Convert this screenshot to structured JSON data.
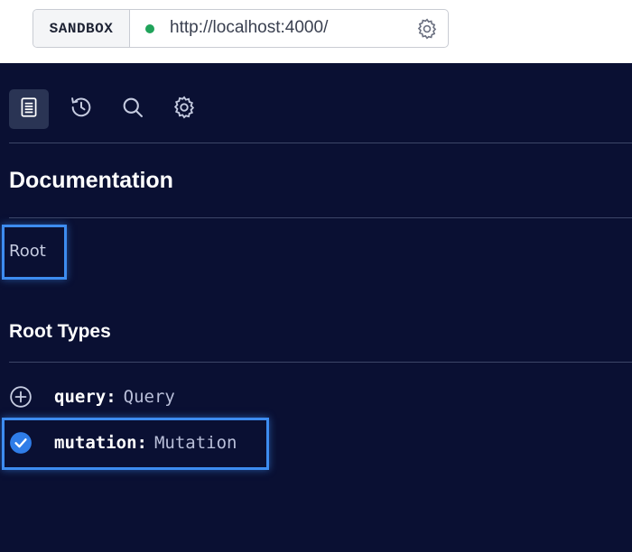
{
  "url_bar": {
    "environment_label": "SANDBOX",
    "url": "http://localhost:4000/",
    "status_color": "#20a35a"
  },
  "toolbar": {
    "items": [
      {
        "icon": "documentation-icon",
        "active": true
      },
      {
        "icon": "history-icon",
        "active": false
      },
      {
        "icon": "search-icon",
        "active": false
      },
      {
        "icon": "gear-icon",
        "active": false
      }
    ]
  },
  "docs": {
    "title": "Documentation",
    "breadcrumb": "Root",
    "root_types_heading": "Root Types",
    "fields": [
      {
        "name": "query",
        "type": "Query",
        "icon": "plus-circle-icon",
        "selected": false
      },
      {
        "name": "mutation",
        "type": "Mutation",
        "icon": "check-circle-icon",
        "selected": true
      }
    ]
  },
  "colors": {
    "background": "#0a1033",
    "highlight": "#3d8cf0",
    "check": "#2f7de8"
  }
}
